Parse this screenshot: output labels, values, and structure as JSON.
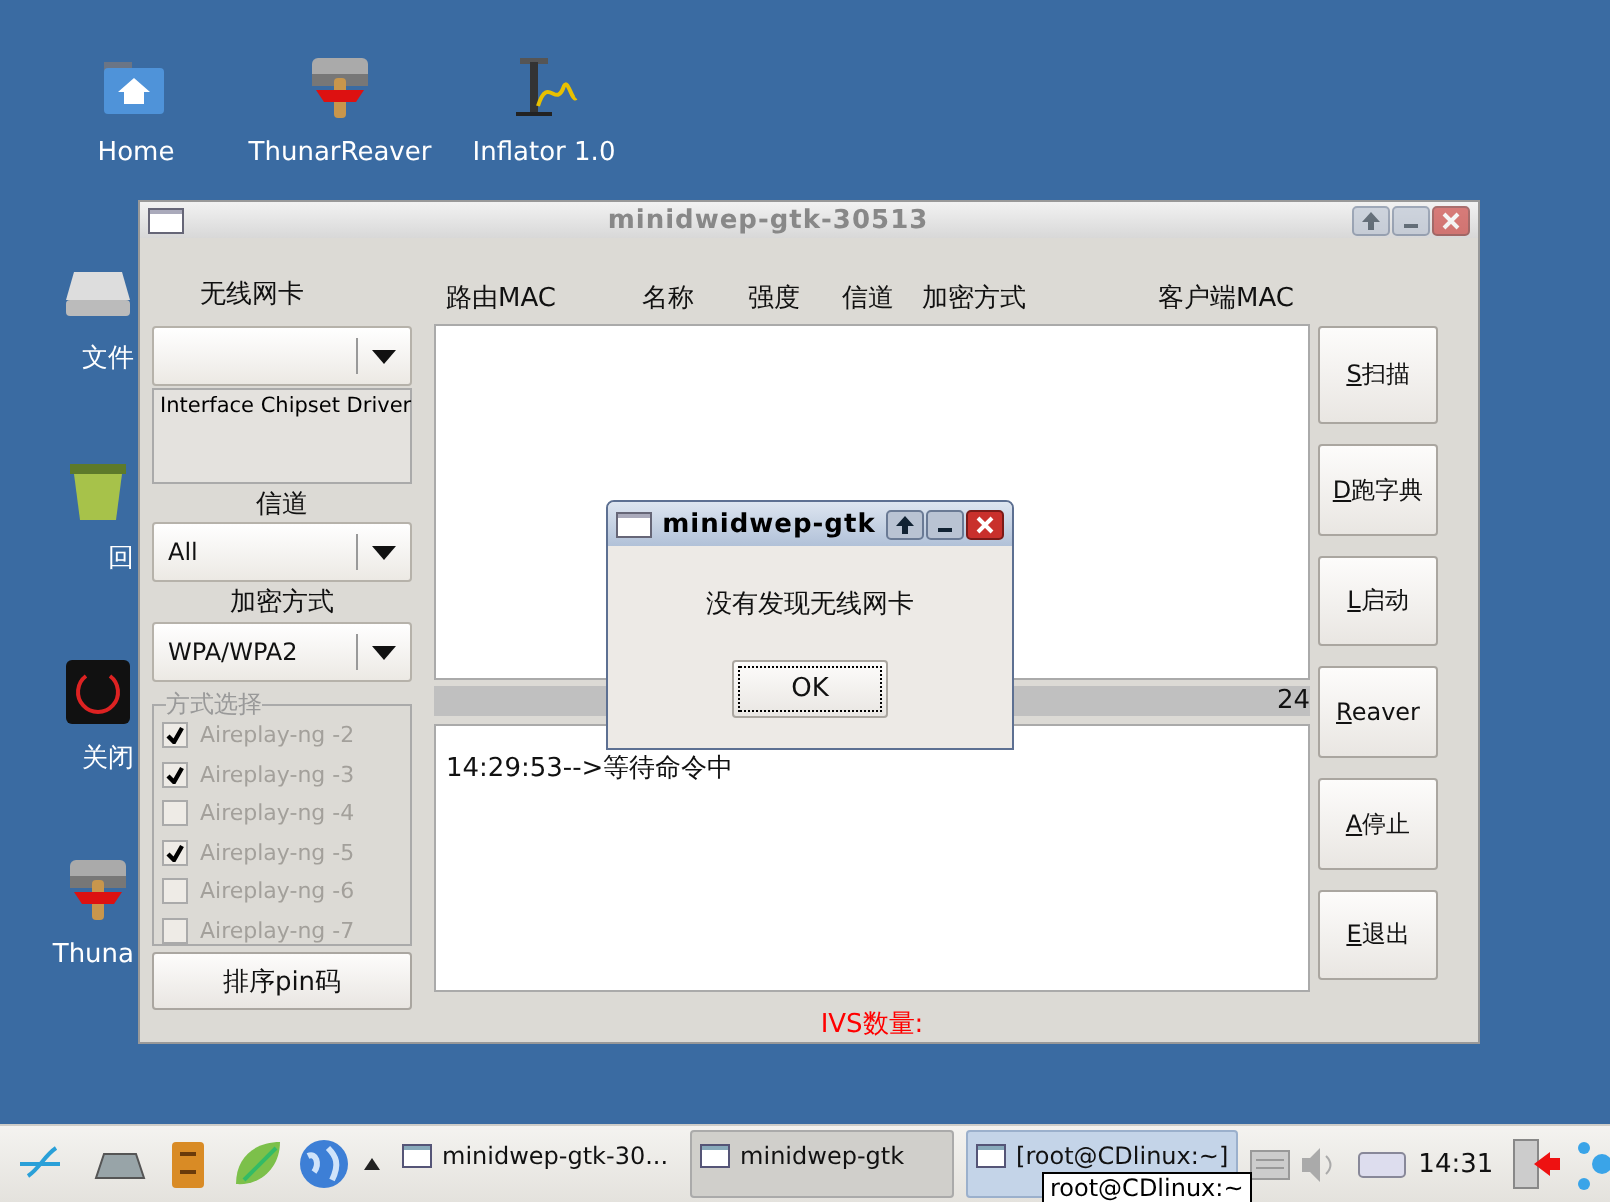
{
  "top_icons": [
    {
      "label": "Home",
      "kind": "home"
    },
    {
      "label": "ThunarReaver",
      "kind": "reaver"
    },
    {
      "label": "Inflator 1.0",
      "kind": "pump"
    }
  ],
  "left_icons": [
    {
      "label": "文件",
      "kind": "drive"
    },
    {
      "label": "回",
      "kind": "trash"
    },
    {
      "label": "关闭",
      "kind": "power"
    },
    {
      "label": "Thuna",
      "kind": "reaver"
    }
  ],
  "main_window": {
    "title": "minidwep-gtk-30513",
    "active": false,
    "left": {
      "card_label": "无线网卡",
      "card_info": "Interface Chipset Driver",
      "channel_label": "信道",
      "channel_combo": {
        "value": "All"
      },
      "encryption_label": "加密方式",
      "encryption_combo": {
        "value": "WPA/WPA2"
      },
      "method_group": {
        "title": "方式选择",
        "disabled": true,
        "options": [
          {
            "label": "Aireplay-ng -2",
            "checked": true
          },
          {
            "label": "Aireplay-ng -3",
            "checked": true
          },
          {
            "label": "Aireplay-ng -4",
            "checked": false
          },
          {
            "label": "Aireplay-ng -5",
            "checked": true
          },
          {
            "label": "Aireplay-ng -6",
            "checked": false
          },
          {
            "label": "Aireplay-ng -7",
            "checked": false
          }
        ]
      },
      "sort_button": "排序pin码"
    },
    "table": {
      "columns": [
        "路由MAC",
        "名称",
        "强度",
        "信道",
        "加密方式",
        "客户端MAC"
      ]
    },
    "progress": {
      "level": 0,
      "reading": "24"
    },
    "log": "14:29:53-->等待命令中",
    "ivs_label": "IVS数量:",
    "buttons": [
      {
        "label": "S扫描",
        "mnemonic": true
      },
      {
        "label": "D跑字典",
        "mnemonic": true
      },
      {
        "label": "L启动",
        "mnemonic": true
      },
      {
        "label": "Reaver",
        "mnemonic": true
      },
      {
        "label": "A停止",
        "mnemonic": true
      },
      {
        "label": "E退出",
        "mnemonic": true
      }
    ]
  },
  "dialog": {
    "title": "minidwep-gtk",
    "active": true,
    "message": "没有发现无线网卡",
    "button": {
      "label": "OK",
      "focused": true
    }
  },
  "taskbar": {
    "tasks": [
      {
        "label": "minidwep-gtk-30...",
        "selected": false,
        "hovered": false
      },
      {
        "label": "minidwep-gtk",
        "selected": true,
        "hovered": false
      },
      {
        "label": "[root@CDlinux:~]",
        "selected": false,
        "hovered": true
      }
    ],
    "clock": "14:31",
    "tooltip": "root@CDlinux:~"
  }
}
